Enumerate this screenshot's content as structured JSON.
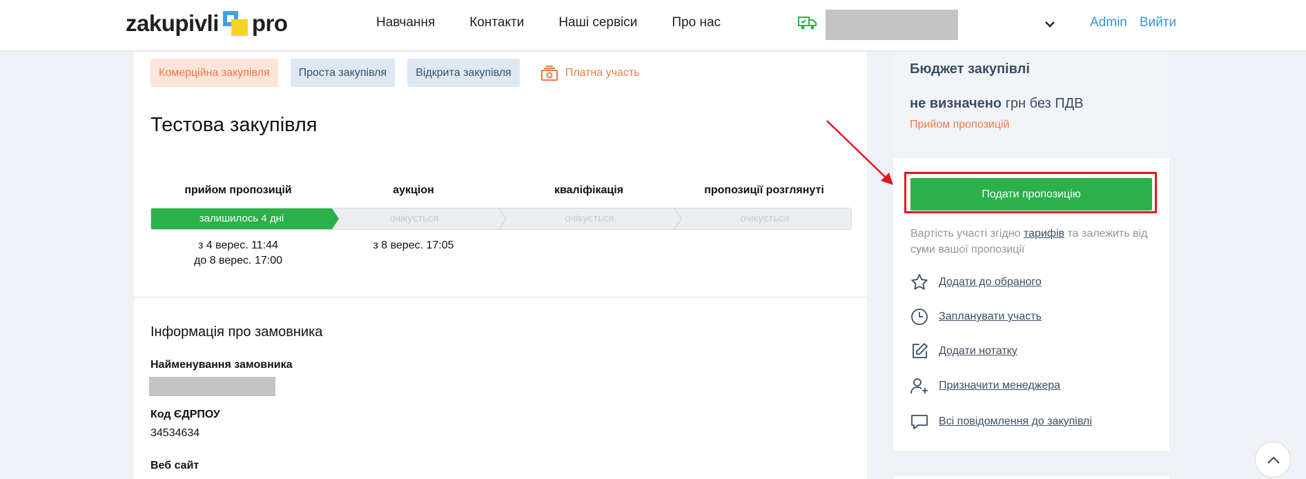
{
  "header": {
    "logo_left": "zakupivli",
    "logo_right": "pro",
    "nav": [
      "Навчання",
      "Контакти",
      "Наші сервіси",
      "Про нас"
    ],
    "user_links": [
      "Admin",
      "Вийти"
    ]
  },
  "tags": {
    "commercial": "Комерційна закупівля",
    "simple": "Проста закупівля",
    "open": "Відкрита закупівля",
    "paid": "Платна участь"
  },
  "title": "Тестова закупівля",
  "stages": {
    "labels": [
      "прийом пропозицій",
      "аукціон",
      "кваліфікація",
      "пропозиції розглянуті"
    ],
    "statuses": [
      "залишилось 4 дні",
      "очікується",
      "очікується",
      "очікується"
    ],
    "date_line1": [
      "з 4 верес. 11:44",
      "з 8 верес. 17:05"
    ],
    "date_line2": [
      "до 8 верес. 17:00"
    ]
  },
  "customer": {
    "section_title": "Інформація про замовника",
    "name_label": "Найменування замовника",
    "code_label": "Код ЄДРПОУ",
    "code_value": "34534634",
    "site_label": "Веб сайт"
  },
  "budget": {
    "title": "Бюджет закупівлі",
    "value_bold": "не визначено",
    "value_rest": " грн без ПДВ",
    "status": "Прийом пропозицій"
  },
  "actions": {
    "submit": "Подати пропозицію",
    "fee_pre": "Вартість участі згідно ",
    "fee_link": "тарифів",
    "fee_post": " та залежить від суми вашої пропозиції",
    "favorite": "Додати до обраного",
    "schedule": "Запланувати участь",
    "note": "Додати нотатку",
    "manager": "Призначити менеджера",
    "messages": "Всі повідомлення до закупівлі"
  },
  "colors": {
    "green": "#2bb04a",
    "orange": "#f07a43",
    "link_blue": "#3b93d9",
    "highlight_red": "#e3171f"
  }
}
